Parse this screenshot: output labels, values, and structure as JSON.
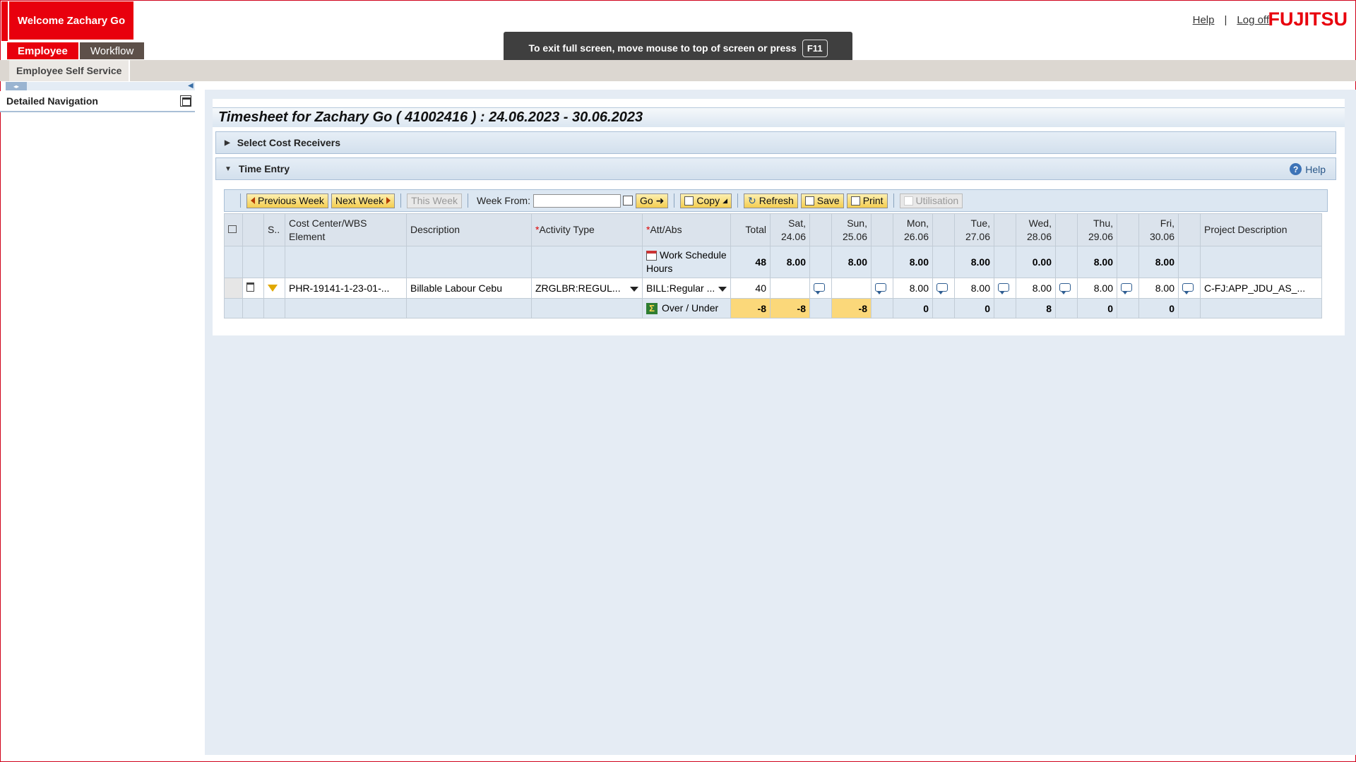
{
  "header": {
    "welcome": "Welcome Zachary Go",
    "help_link": "Help",
    "separator": "|",
    "logoff_link": "Log off",
    "logo": "FUJITSU",
    "fullscreen_note": "To exit full screen, move mouse to top of screen or press",
    "fullscreen_key": "F11"
  },
  "tabs": [
    {
      "label": "Employee",
      "active": true
    },
    {
      "label": "Workflow",
      "active": false
    }
  ],
  "subtab": "Employee Self Service",
  "nav": {
    "title": "Detailed Navigation"
  },
  "page": {
    "title": "Timesheet for Zachary Go ( 41002416 ) : 24.06.2023 - 30.06.2023",
    "tray_cost": "Select Cost Receivers",
    "tray_time": "Time Entry",
    "tray_help": "Help"
  },
  "toolbar": {
    "prev_week": "Previous Week",
    "next_week": "Next Week",
    "this_week": "This Week",
    "week_from_label": "Week From:",
    "week_from_value": "",
    "go": "Go",
    "copy": "Copy",
    "refresh": "Refresh",
    "save": "Save",
    "print": "Print",
    "utilisation": "Utilisation"
  },
  "grid": {
    "headers": {
      "s": "S..",
      "cost": "Cost Center/WBS Element",
      "desc": "Description",
      "activity_req": "*",
      "activity": "Activity Type",
      "attabs_req": "*",
      "attabs": "Att/Abs",
      "total": "Total",
      "sat": "Sat,",
      "sat_d": "24.06",
      "sun": "Sun,",
      "sun_d": "25.06",
      "mon": "Mon,",
      "mon_d": "26.06",
      "tue": "Tue,",
      "tue_d": "27.06",
      "wed": "Wed,",
      "wed_d": "28.06",
      "thu": "Thu,",
      "thu_d": "29.06",
      "fri": "Fri,",
      "fri_d": "30.06",
      "project": "Project Description"
    },
    "schedule_row": {
      "label": "Work Schedule Hours",
      "total": "48",
      "sat": "8.00",
      "sun": "8.00",
      "mon": "8.00",
      "tue": "8.00",
      "wed": "0.00",
      "thu": "8.00",
      "fri": "8.00"
    },
    "data_row": {
      "cost": "PHR-19141-1-23-01-...",
      "desc": "Billable Labour Cebu",
      "activity": "ZRGLBR:REGUL...",
      "attabs": "BILL:Regular ...",
      "total": "40",
      "sat": "",
      "sun": "",
      "mon": "8.00",
      "tue": "8.00",
      "wed": "8.00",
      "thu": "8.00",
      "fri": "8.00",
      "project": "C-FJ:APP_JDU_AS_..."
    },
    "over_row": {
      "label": "Over / Under",
      "total": "-8",
      "sat": "-8",
      "sun": "-8",
      "mon": "0",
      "tue": "0",
      "wed": "8",
      "thu": "0",
      "fri": "0"
    }
  },
  "colors": {
    "brand_red": "#e8000d",
    "highlight_yellow": "#fbd87a",
    "panel_blue": "#e5ecf4"
  }
}
